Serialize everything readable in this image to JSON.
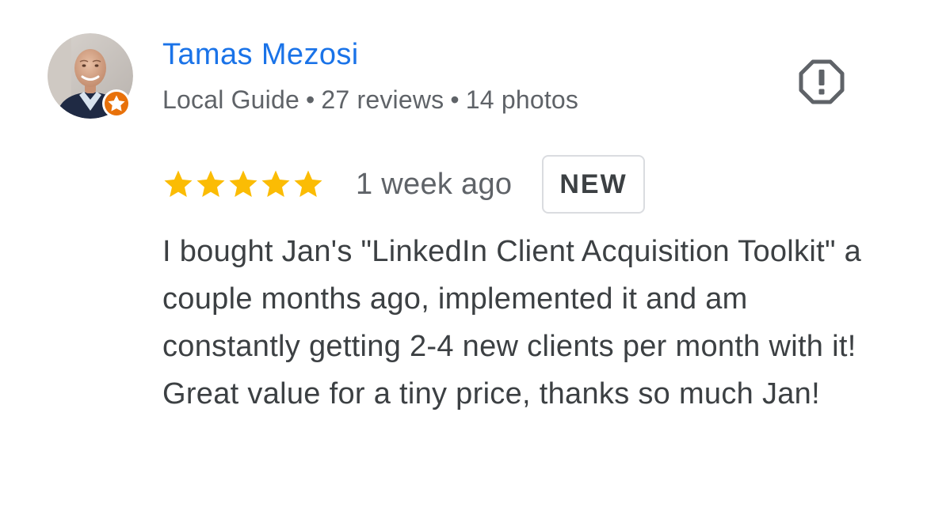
{
  "reviewer": {
    "name": "Tamas Mezosi",
    "role": "Local Guide",
    "separator": "•",
    "reviews": "27 reviews",
    "photos": "14 photos"
  },
  "review": {
    "rating": 5,
    "rating_max": 5,
    "date": "1 week ago",
    "badge": "NEW",
    "text": "I bought Jan's \"LinkedIn Client Acquisition Toolkit\" a couple months ago, implemented it and am constantly getting 2-4 new clients per month with it! Great value for a tiny price, thanks so much Jan!"
  },
  "icons": {
    "report": "report-octagon-icon",
    "star": "star-icon",
    "guide_badge": "local-guide-star-icon"
  },
  "colors": {
    "name_link": "#1a73e8",
    "meta_text": "#5f6368",
    "star": "#fbbc04",
    "guide_badge": "#e8710a",
    "body_text": "#3c4043"
  }
}
